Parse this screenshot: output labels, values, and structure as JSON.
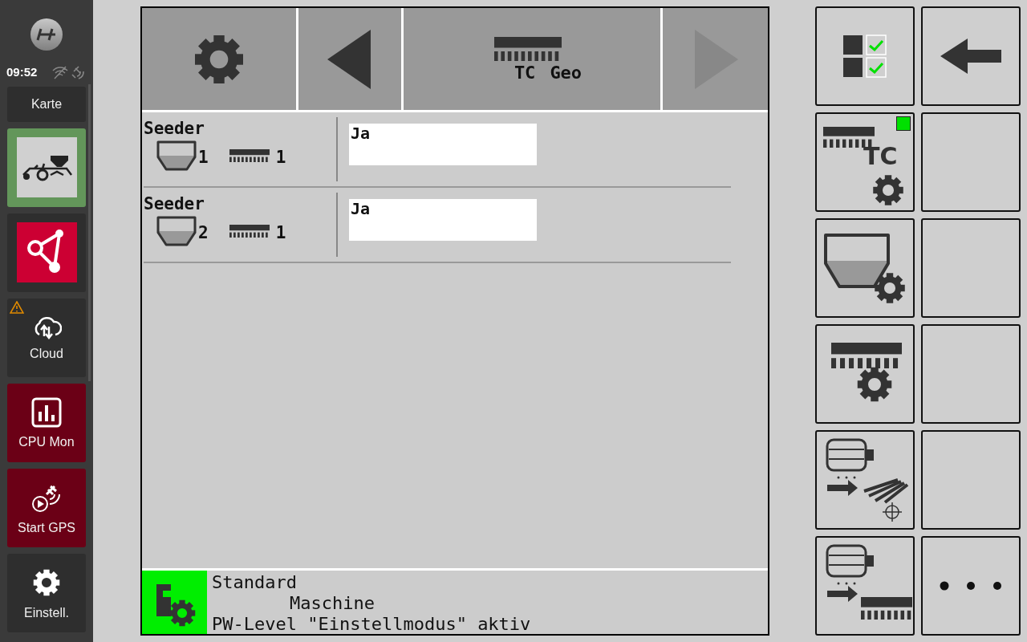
{
  "sidebar": {
    "clock": "09:52",
    "items": [
      {
        "kind": "plain",
        "label": "Karte",
        "selected": false
      },
      {
        "kind": "seeder",
        "selected": true
      },
      {
        "kind": "network",
        "selected": false
      },
      {
        "kind": "cloud",
        "label": "Cloud",
        "warning": true,
        "selected": false
      },
      {
        "kind": "cpu",
        "label": "CPU Mon",
        "selected": false
      },
      {
        "kind": "gps",
        "label": "Start GPS",
        "selected": false
      },
      {
        "kind": "settings",
        "label": "Einstell.",
        "selected": false
      }
    ]
  },
  "header": {
    "title_parts": [
      "TC",
      "Geo"
    ],
    "prev_disabled": false,
    "next_disabled": true
  },
  "rows": [
    {
      "label": "Seeder",
      "tank": "1",
      "section": "1",
      "value": "Ja"
    },
    {
      "label": "Seeder",
      "tank": "2",
      "section": "1",
      "value": "Ja"
    }
  ],
  "status": {
    "lines": [
      {
        "text": "Standard",
        "indent": false
      },
      {
        "text": "Maschine",
        "indent": true
      },
      {
        "text": "PW-Level \"Einstellmodus\" aktiv",
        "indent": false
      }
    ]
  },
  "softkeys": [
    {
      "kind": "checklist"
    },
    {
      "kind": "back"
    },
    {
      "kind": "tc-settings",
      "label": "TC",
      "indicator": true
    },
    {
      "kind": "empty"
    },
    {
      "kind": "tank-settings"
    },
    {
      "kind": "empty"
    },
    {
      "kind": "boom-settings"
    },
    {
      "kind": "empty"
    },
    {
      "kind": "meter-geo"
    },
    {
      "kind": "empty"
    },
    {
      "kind": "meter-sections"
    },
    {
      "kind": "more"
    }
  ]
}
